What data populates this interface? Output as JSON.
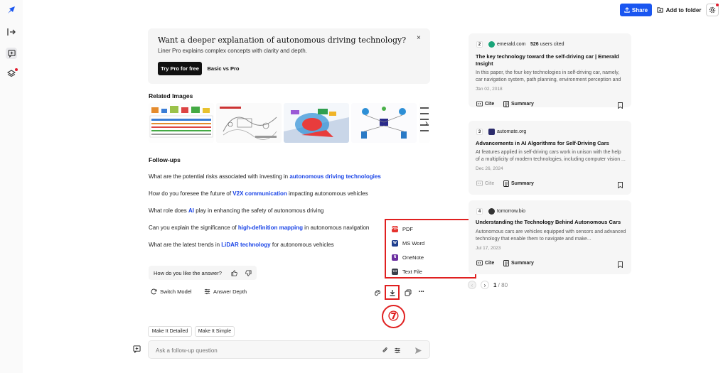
{
  "promo": {
    "title": "Want a deeper explanation of autonomous driving technology?",
    "subtitle": "Liner Pro explains complex concepts with clarity and depth.",
    "try_label": "Try Pro for free",
    "basic_label": "Basic vs Pro",
    "close": "×"
  },
  "header": {
    "share_label": "Share",
    "folder_label": "Add to folder"
  },
  "related_images": {
    "title": "Related Images",
    "next": "›"
  },
  "followups": {
    "title": "Follow-ups",
    "items": [
      {
        "pre": "What are the potential risks associated with investing in ",
        "hl": "autonomous driving technologies",
        "post": ""
      },
      {
        "pre": "How do you foresee the future of ",
        "hl": "V2X communication",
        "post": " impacting autonomous vehicles"
      },
      {
        "pre": "What role does ",
        "hl": "AI",
        "post": " play in enhancing the safety of autonomous driving"
      },
      {
        "pre": "Can you explain the significance of ",
        "hl": "high-definition mapping",
        "post": " in autonomous navigation"
      },
      {
        "pre": "What are the latest trends in ",
        "hl": "LiDAR technology",
        "post": " for autonomous vehicles"
      }
    ]
  },
  "feedback": {
    "label": "How do you like the answer?"
  },
  "toolbar": {
    "switch_model": "Switch Model",
    "answer_depth": "Answer Depth",
    "more": "•••"
  },
  "export_menu": {
    "items": [
      {
        "label": "PDF",
        "icon_text": "PDF",
        "color": "#e5322d"
      },
      {
        "label": "MS Word",
        "icon_text": "W",
        "color": "#1f3f8f"
      },
      {
        "label": "OneNote",
        "icon_text": "N",
        "color": "#6b2fa0"
      },
      {
        "label": "Text File",
        "icon_text": "TXT",
        "color": "#3a3f4a"
      }
    ]
  },
  "annotation": {
    "step": "⑦",
    "color": "#e02020"
  },
  "chips": {
    "detailed": "Make It Detailed",
    "simple": "Make It Simple"
  },
  "ask": {
    "placeholder": "Ask a follow-up question"
  },
  "sources": [
    {
      "num": "2",
      "domain": "emerald.com",
      "cites_count": "526",
      "cites_suffix": " users cited",
      "title": "The key technology toward the self-driving car | Emerald Insight",
      "snippet": "In this paper, the four key technologies in self-driving car, namely, car navigation system, path planning, environment perception and ...",
      "date": "Jan 02, 2018",
      "fav_color": "#1aa57a",
      "cite": "Cite",
      "summary": "Summary"
    },
    {
      "num": "3",
      "domain": "automate.org",
      "cites_count": "",
      "cites_suffix": "",
      "title": "Advancements in AI Algorithms for Self-Driving Cars",
      "snippet": "AI features applied in self-driving cars work in unison with the help of a multiplicity of modern technologies, including computer vision ...",
      "date": "Dec 26, 2024",
      "fav_color": "#2b2b6b",
      "cite": "Cite",
      "summary": "Summary"
    },
    {
      "num": "4",
      "domain": "tomorrow.bio",
      "cites_count": "",
      "cites_suffix": "",
      "title": "Understanding the Technology Behind Autonomous Cars",
      "snippet": "Autonomous cars are vehicles equipped with sensors and advanced technology that enable them to navigate and make...",
      "date": "Jul 17, 2023",
      "fav_color": "#333333",
      "cite": "Cite",
      "summary": "Summary"
    }
  ],
  "pager": {
    "current": "1",
    "total": " / 80"
  },
  "colors": {
    "accent": "#1a56f0",
    "highlight": "#1a44e6",
    "annotation_red": "#e02020"
  }
}
